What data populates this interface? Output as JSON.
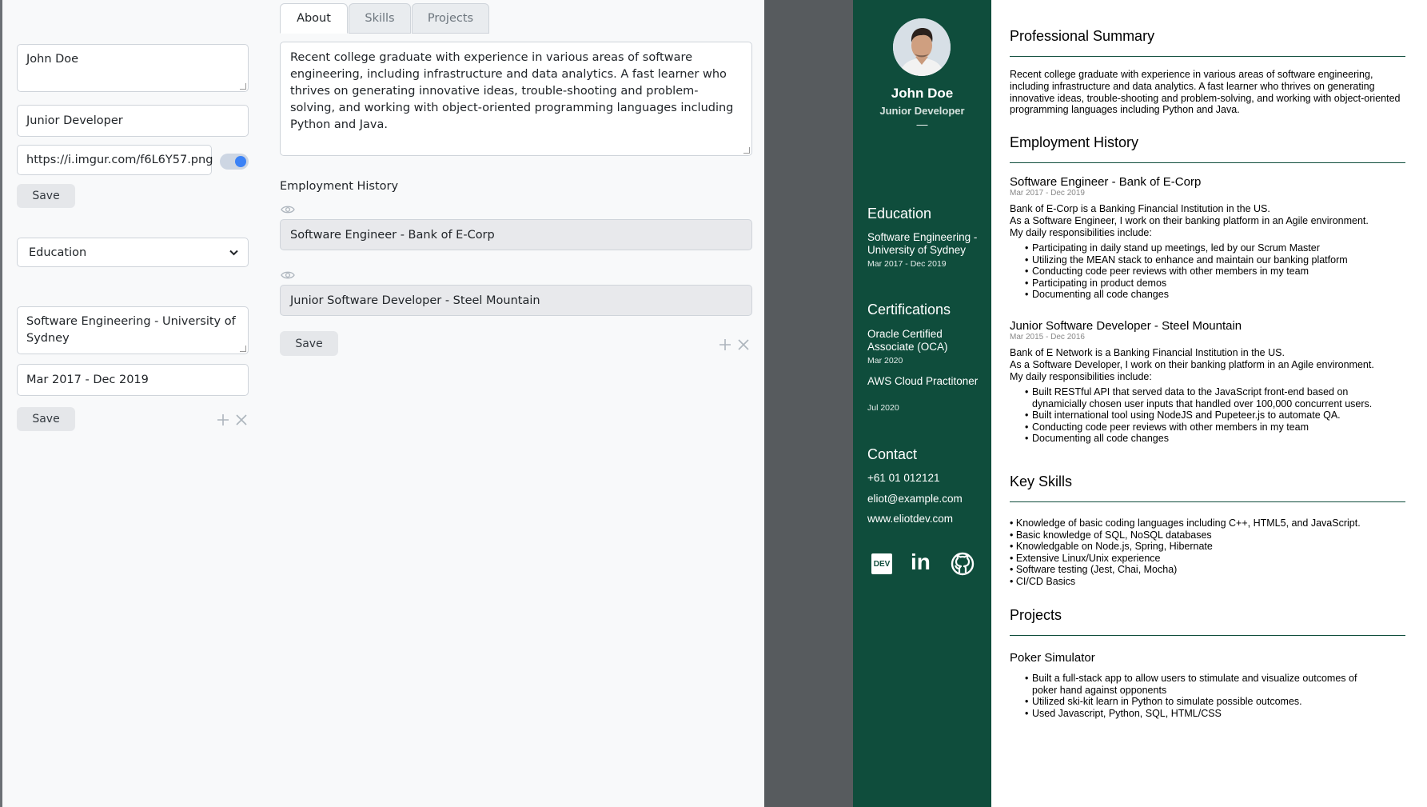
{
  "editor": {
    "profile": {
      "name": "John Doe",
      "title": "Junior Developer",
      "photo_url": "https://i.imgur.com/f6L6Y57.png",
      "photo_toggle_on": true,
      "save_label": "Save"
    },
    "section_select": {
      "selected": "Education"
    },
    "education_entry": {
      "degree": "Software Engineering - University of Sydney",
      "dates": "Mar 2017 - Dec 2019",
      "save_label": "Save"
    },
    "tabs": [
      {
        "label": "About",
        "active": true
      },
      {
        "label": "Skills",
        "active": false
      },
      {
        "label": "Projects",
        "active": false
      }
    ],
    "about_text": "Recent college graduate with experience in various areas of software engineering, including infrastructure and data analytics. A fast learner who thrives on generating innovative ideas, trouble-shooting and problem-solving, and working with object-oriented programming languages including Python and Java.",
    "employment": {
      "label": "Employment History",
      "items": [
        "Software Engineer - Bank of E-Corp",
        "Junior Software Developer - Steel Mountain"
      ],
      "save_label": "Save"
    }
  },
  "resume": {
    "sidebar": {
      "name": "John Doe",
      "title": "Junior Developer",
      "dash": "—",
      "education_heading": "Education",
      "education": [
        {
          "title": "Software Engineering - University of Sydney",
          "date": "Mar 2017 - Dec 2019"
        }
      ],
      "certifications_heading": "Certifications",
      "certifications": [
        {
          "title": "Oracle Certified Associate (OCA)",
          "date": "Mar 2020"
        },
        {
          "title": "AWS Cloud Practitoner",
          "date": "Jul 2020"
        }
      ],
      "contact_heading": "Contact",
      "phone": "+61 01 012121",
      "email": "eliot@example.com",
      "website": "www.eliotdev.com",
      "social": {
        "dev": "DEV",
        "linkedin": "in"
      }
    },
    "main": {
      "summary_heading": "Professional Summary",
      "summary": "Recent college graduate with experience in various areas of software engineering, including infrastructure and data analytics. A fast learner who thrives on generating innovative ideas, trouble-shooting and problem-solving, and working with object-oriented programming languages including Python and Java.",
      "employment_heading": "Employment History",
      "jobs": [
        {
          "title": "Software Engineer - Bank of E-Corp",
          "date": "Mar 2017 - Dec 2019",
          "desc": [
            "Bank of E-Corp is a Banking Financial Institution in the US.",
            "As a Software Engineer, I work on their banking platform in an Agile environment.",
            "My daily responsibilities include:"
          ],
          "bullets": [
            "Participating in daily stand up meetings, led by our Scrum Master",
            "Utilizing the MEAN stack to enhance and maintain our banking platform",
            "Conducting code peer reviews with other members in my team",
            "Participating in product demos",
            "Documenting all code changes"
          ]
        },
        {
          "title": "Junior Software Developer - Steel Mountain",
          "date": "Mar 2015 - Dec 2016",
          "desc": [
            "Bank of E Network is a Banking Financial Institution in the US.",
            "As a Software Developer, I work on their banking platform in an Agile environment.",
            "My daily responsibilities include:"
          ],
          "bullets": [
            "Built RESTful API that served data to the JavaScript front-end based on dynamicially chosen user inputs that handled over 100,000 concurrent users.",
            "Built international tool using NodeJS and Pupeteer.js to automate QA.",
            "Conducting code peer reviews with other members in my team",
            "Documenting all code changes"
          ]
        }
      ],
      "skills_heading": "Key Skills",
      "skills": [
        "Knowledge of basic coding languages including C++, HTML5, and JavaScript.",
        "Basic knowledge of  SQL, NoSQL databases",
        "Knowledgable on Node.js, Spring, Hibernate",
        "Extensive Linux/Unix experience",
        "Software testing (Jest, Chai, Mocha)",
        "CI/CD Basics"
      ],
      "projects_heading": "Projects",
      "projects": [
        {
          "title": "Poker Simulator",
          "bullets": [
            "Built a full-stack app to allow users to stimulate and visualize outcomes of poker hand against opponents",
            "Utilized ski-kit learn in Python to simulate possible outcomes.",
            "Used Javascript, Python, SQL, HTML/CSS"
          ]
        }
      ]
    }
  }
}
